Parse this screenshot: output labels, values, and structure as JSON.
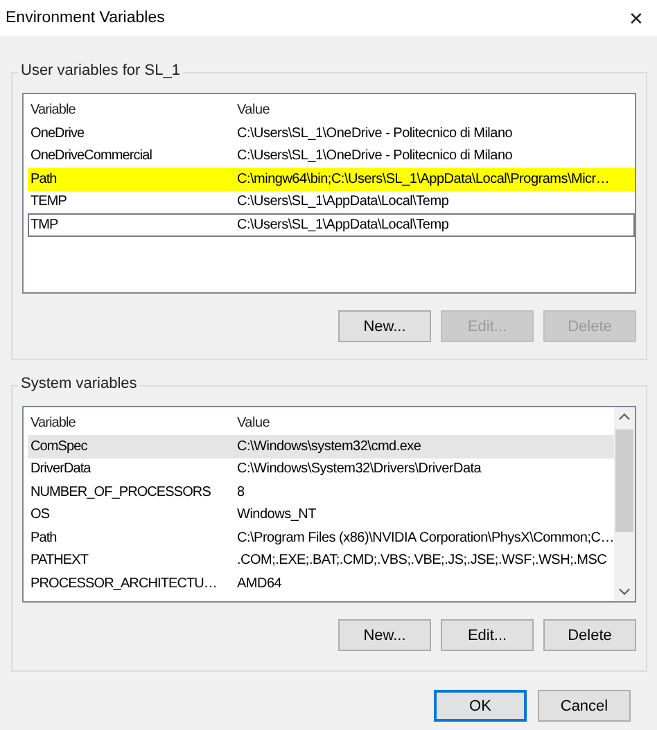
{
  "window": {
    "title": "Environment Variables",
    "close": "✕"
  },
  "user_group": {
    "label": "User variables for SL_1",
    "columns": [
      "Variable",
      "Value"
    ],
    "rows": [
      {
        "variable": "OneDrive",
        "value": "C:\\Users\\SL_1\\OneDrive - Politecnico di Milano",
        "selected": false,
        "focused": false
      },
      {
        "variable": "OneDriveCommercial",
        "value": "C:\\Users\\SL_1\\OneDrive - Politecnico di Milano",
        "selected": false,
        "focused": false
      },
      {
        "variable": "Path",
        "value": "C:\\mingw64\\bin;C:\\Users\\SL_1\\AppData\\Local\\Programs\\Micr…",
        "selected": true,
        "focused": false
      },
      {
        "variable": "TEMP",
        "value": "C:\\Users\\SL_1\\AppData\\Local\\Temp",
        "selected": false,
        "focused": false
      },
      {
        "variable": "TMP",
        "value": "C:\\Users\\SL_1\\AppData\\Local\\Temp",
        "selected": false,
        "focused": true
      }
    ],
    "buttons": [
      {
        "label": "New...",
        "disabled": false
      },
      {
        "label": "Edit...",
        "disabled": true
      },
      {
        "label": "Delete",
        "disabled": true
      }
    ]
  },
  "system_group": {
    "label": "System variables",
    "columns": [
      "Variable",
      "Value"
    ],
    "rows": [
      {
        "variable": "ComSpec",
        "value": "C:\\Windows\\system32\\cmd.exe",
        "selected": true,
        "focused": false
      },
      {
        "variable": "DriverData",
        "value": "C:\\Windows\\System32\\Drivers\\DriverData",
        "selected": false,
        "focused": false
      },
      {
        "variable": "NUMBER_OF_PROCESSORS",
        "value": "8",
        "selected": false,
        "focused": false
      },
      {
        "variable": "OS",
        "value": "Windows_NT",
        "selected": false,
        "focused": false
      },
      {
        "variable": "Path",
        "value": "C:\\Program Files (x86)\\NVIDIA Corporation\\PhysX\\Common;C…",
        "selected": false,
        "focused": false
      },
      {
        "variable": "PATHEXT",
        "value": ".COM;.EXE;.BAT;.CMD;.VBS;.VBE;.JS;.JSE;.WSF;.WSH;.MSC",
        "selected": false,
        "focused": false
      },
      {
        "variable": "PROCESSOR_ARCHITECTU…",
        "value": "AMD64",
        "selected": false,
        "focused": false
      }
    ],
    "buttons": [
      {
        "label": "New...",
        "disabled": false
      },
      {
        "label": "Edit...",
        "disabled": false
      },
      {
        "label": "Delete",
        "disabled": false
      }
    ]
  },
  "footer_buttons": [
    {
      "label": "OK",
      "default": true
    },
    {
      "label": "Cancel",
      "default": false
    }
  ]
}
